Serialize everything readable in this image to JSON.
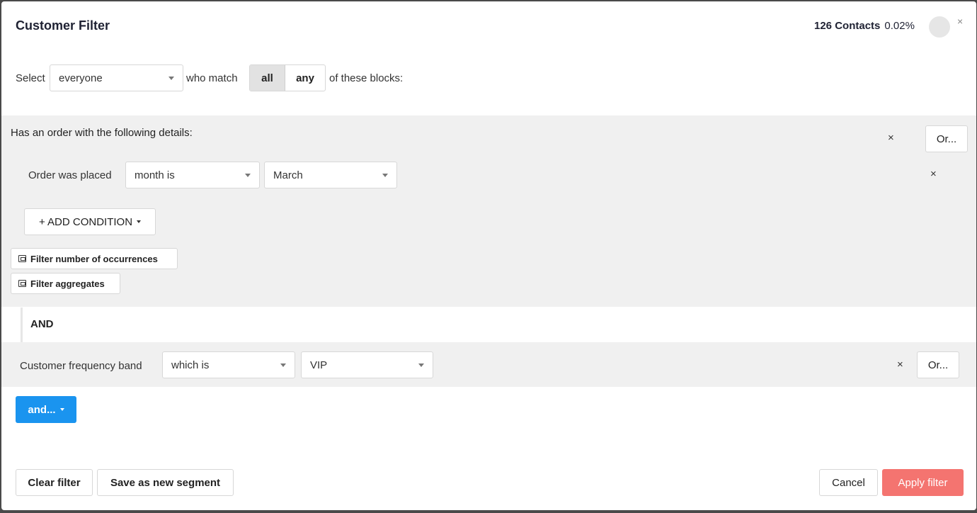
{
  "header": {
    "title": "Customer Filter",
    "contacts_count": "126 Contacts",
    "contacts_pct": "0.02%",
    "close_glyph": "×"
  },
  "selector": {
    "select_label": "Select",
    "audience_value": "everyone",
    "who_match_label": "who match",
    "match_options": [
      "all",
      "any"
    ],
    "match_selected": "all",
    "suffix_label": "of these blocks:"
  },
  "block1": {
    "title": "Has an order with the following details:",
    "remove_glyph": "×",
    "or_label": "Or...",
    "condition": {
      "label": "Order was placed",
      "operator": "month is",
      "value": "March",
      "remove_glyph": "×"
    },
    "add_condition_label": "+ ADD CONDITION",
    "filter_occurrences_label": "Filter number of occurrences",
    "filter_aggregates_label": "Filter aggregates"
  },
  "connector": {
    "label": "AND"
  },
  "block2": {
    "label": "Customer frequency band",
    "operator": "which is",
    "value": "VIP",
    "remove_glyph": "×",
    "or_label": "Or..."
  },
  "and_button": {
    "label": "and..."
  },
  "footer": {
    "clear_label": "Clear filter",
    "save_label": "Save as new segment",
    "cancel_label": "Cancel",
    "apply_label": "Apply filter"
  },
  "colors": {
    "primary": "#1a94ef",
    "apply": "#f47470",
    "band_bg": "#f0f0f0"
  }
}
